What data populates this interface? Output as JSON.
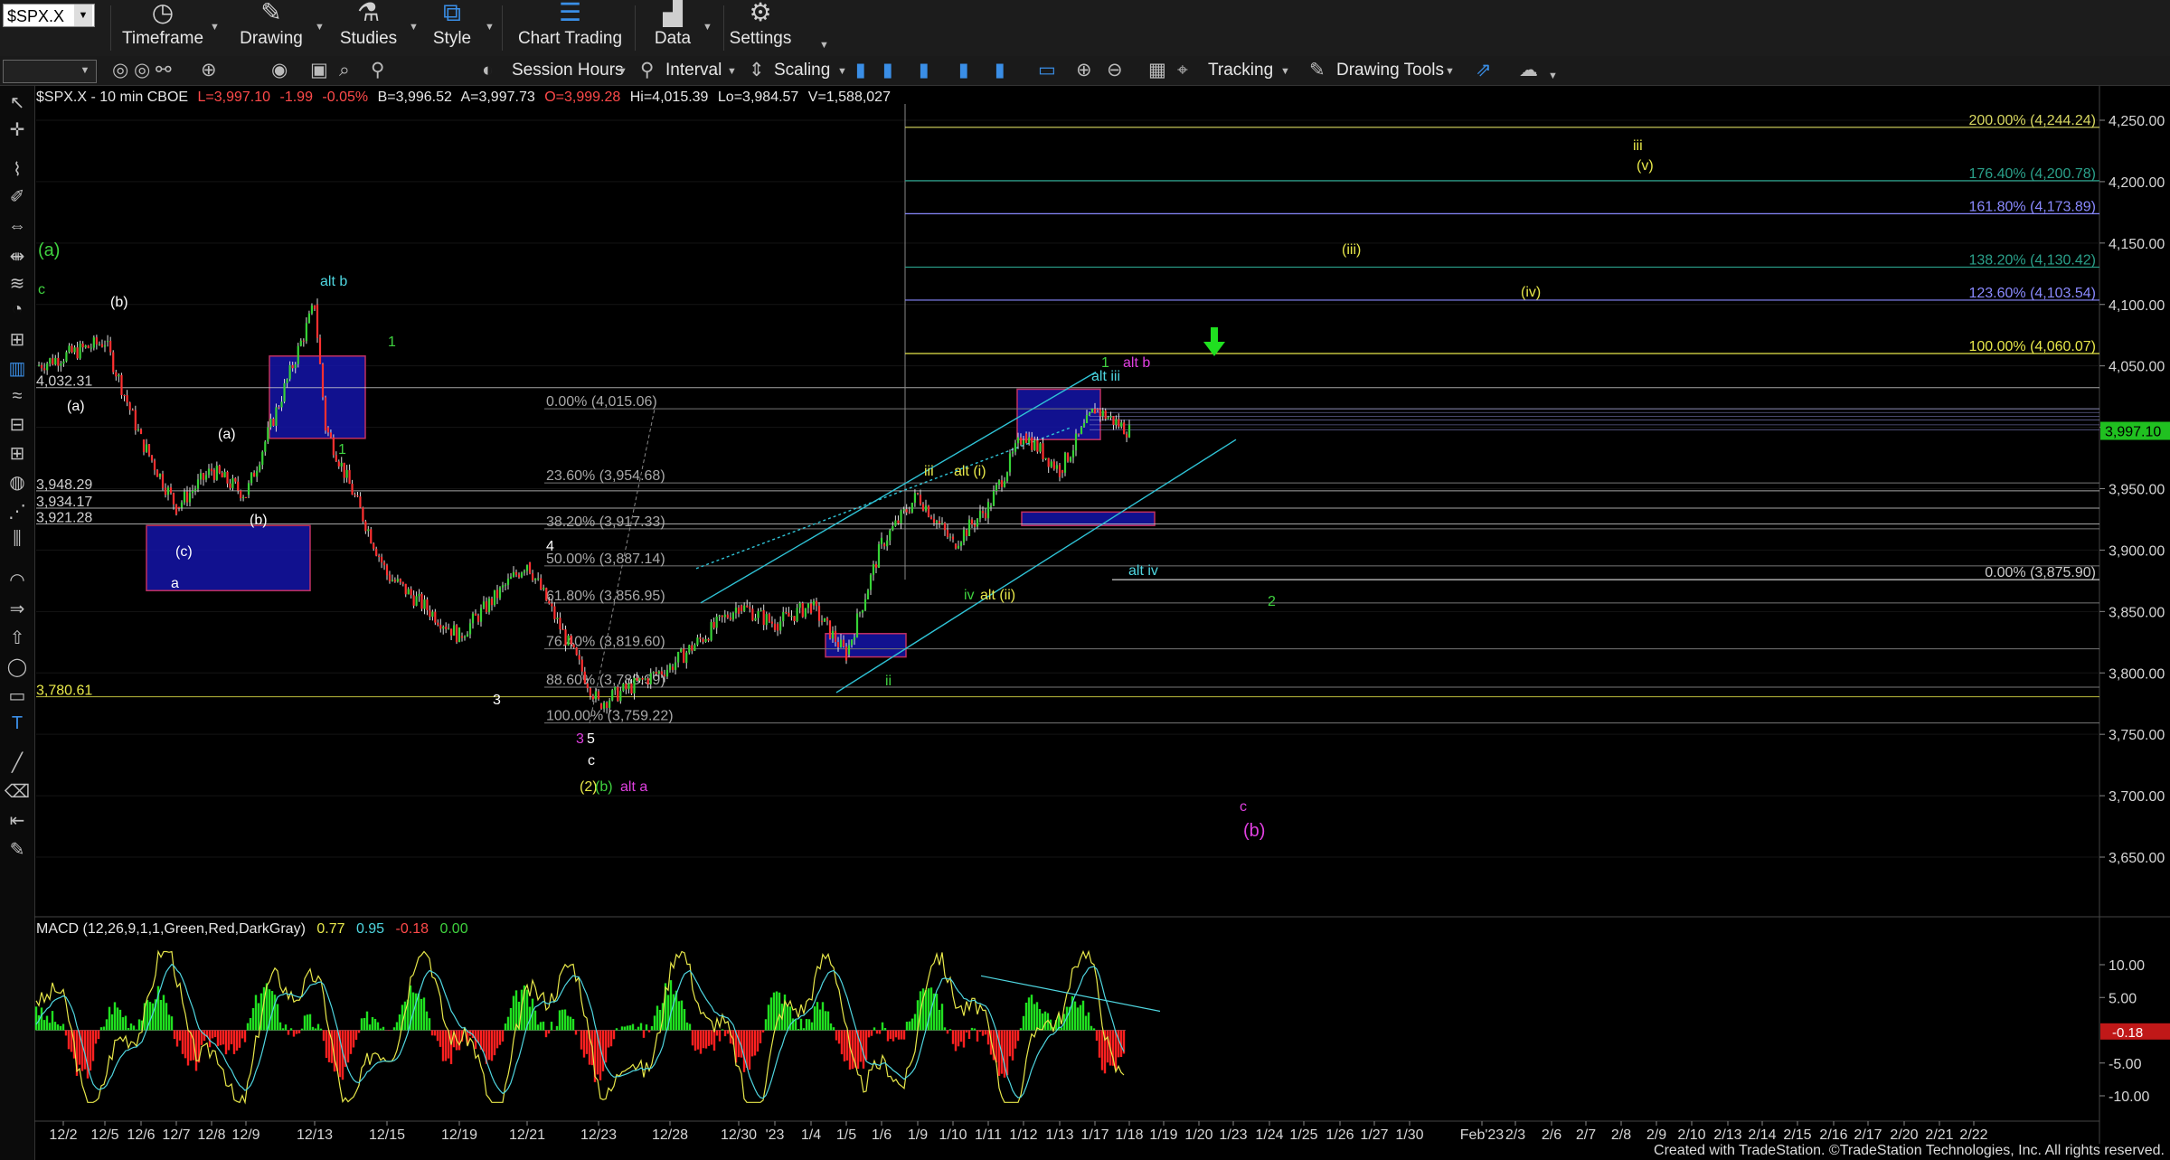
{
  "toolbar": {
    "symbol": "$SPX.X",
    "groups": [
      {
        "label": "Timeframe",
        "icon": "clock-icon"
      },
      {
        "label": "Drawing",
        "icon": "pencil-icon"
      },
      {
        "label": "Studies",
        "icon": "flask-icon"
      },
      {
        "label": "Style",
        "icon": "style-icon"
      },
      {
        "label": "Chart Trading",
        "icon": "chart-trading-icon"
      },
      {
        "label": "Data",
        "icon": "bar-chart-icon"
      },
      {
        "label": "Settings",
        "icon": "gear-icon"
      }
    ],
    "session_hours": "Session Hours",
    "interval": "Interval",
    "scaling": "Scaling",
    "tracking": "Tracking",
    "drawing_tools": "Drawing Tools"
  },
  "header": {
    "symbol_info": "$SPX.X - 10 min  CBOE",
    "last": "L=3,997.10",
    "change": "-1.99",
    "pct": "-0.05%",
    "bid": "B=3,996.52",
    "ask": "A=3,997.73",
    "open": "O=3,999.28",
    "high": "Hi=4,015.39",
    "low": "Lo=3,984.57",
    "volume": "V=1,588,027"
  },
  "chart_data": [
    {
      "type": "candlestick",
      "title": "$SPX.X - 10 min",
      "ylim": [
        3600,
        4270
      ],
      "y_ticks": [
        "4,250.00",
        "4,200.00",
        "4,150.00",
        "4,100.00",
        "4,050.00",
        "4,000.00",
        "3,950.00",
        "3,900.00",
        "3,850.00",
        "3,800.00",
        "3,750.00",
        "3,700.00",
        "3,650.00"
      ],
      "y_tick_values": [
        4250,
        4200,
        4150,
        4100,
        4050,
        4000,
        3950,
        3900,
        3850,
        3800,
        3750,
        3700,
        3650
      ],
      "x_ticks": [
        "12/2",
        "12/5",
        "12/6",
        "12/7",
        "12/8",
        "12/9",
        "12/13",
        "12/15",
        "12/19",
        "12/21",
        "12/23",
        "12/28",
        "12/30",
        "'23",
        "1/4",
        "1/5",
        "1/6",
        "1/9",
        "1/10",
        "1/11",
        "1/12",
        "1/13",
        "1/17",
        "1/18",
        "1/19",
        "1/20",
        "1/23",
        "1/24",
        "1/25",
        "1/26",
        "1/27",
        "1/30",
        "Feb'23",
        "2/3",
        "2/6",
        "2/7",
        "2/8",
        "2/9",
        "2/10",
        "2/13",
        "2/14",
        "2/15",
        "2/16",
        "2/17",
        "2/20",
        "2/21",
        "2/22"
      ],
      "last_price": "3,997.10",
      "price_path": [
        [
          "12/2",
          4050
        ],
        [
          "12/5",
          4070
        ],
        [
          "12/6",
          3990
        ],
        [
          "12/7",
          3935
        ],
        [
          "12/8",
          3965
        ],
        [
          "12/9",
          3945
        ],
        [
          "12/13",
          4100
        ],
        [
          "12/13",
          4000
        ],
        [
          "12/15",
          3880
        ],
        [
          "12/19",
          3830
        ],
        [
          "12/21",
          3890
        ],
        [
          "12/23",
          3775
        ],
        [
          "12/28",
          3805
        ],
        [
          "12/30",
          3855
        ],
        [
          "'23",
          3840
        ],
        [
          "1/4",
          3855
        ],
        [
          "1/5",
          3815
        ],
        [
          "1/6",
          3905
        ],
        [
          "1/9",
          3945
        ],
        [
          "1/10",
          3905
        ],
        [
          "1/11",
          3935
        ],
        [
          "1/12",
          3995
        ],
        [
          "1/13",
          3965
        ],
        [
          "1/17",
          4015
        ],
        [
          "1/18",
          3997
        ]
      ],
      "horizontal_levels": [
        {
          "label": "4,032.31",
          "value": 4032.31
        },
        {
          "label": "3,948.29",
          "value": 3948.29
        },
        {
          "label": "3,934.17",
          "value": 3934.17
        },
        {
          "label": "3,921.28",
          "value": 3921.28
        },
        {
          "label": "3,780.61",
          "value": 3780.61
        }
      ],
      "retracement_fib": [
        {
          "label": "0.00% (4,015.06)",
          "value": 4015.06
        },
        {
          "label": "23.60% (3,954.68)",
          "value": 3954.68
        },
        {
          "label": "38.20% (3,917.33)",
          "value": 3917.33
        },
        {
          "label": "50.00% (3,887.14)",
          "value": 3887.14
        },
        {
          "label": "61.80% (3,856.95)",
          "value": 3856.95
        },
        {
          "label": "76.40% (3,819.60)",
          "value": 3819.6
        },
        {
          "label": "88.60% (3,788.39)",
          "value": 3788.39
        },
        {
          "label": "100.00% (3,759.22)",
          "value": 3759.22
        }
      ],
      "extension_fib": [
        {
          "label": "200.00% (4,244.24)",
          "value": 4244.24,
          "color": "#d8d860"
        },
        {
          "label": "176.40% (4,200.78)",
          "value": 4200.78,
          "color": "#2aa08a"
        },
        {
          "label": "161.80% (4,173.89)",
          "value": 4173.89,
          "color": "#8a8aff"
        },
        {
          "label": "138.20% (4,130.42)",
          "value": 4130.42,
          "color": "#2aa08a"
        },
        {
          "label": "123.60% (4,103.54)",
          "value": 4103.54,
          "color": "#8a8aff"
        },
        {
          "label": "100.00% (4,060.07)",
          "value": 4060.07,
          "color": "#e8e84a"
        },
        {
          "label": "0.00% (3,875.90)",
          "value": 3875.9,
          "color": "#cccccc"
        }
      ],
      "wave_labels": [
        {
          "text": "(a)",
          "color": "#3fd23f"
        },
        {
          "text": "c",
          "color": "#3fd23f"
        },
        {
          "text": "(b)",
          "color": "#ffffff"
        },
        {
          "text": "(a)",
          "color": "#ffffff"
        },
        {
          "text": "alt b",
          "color": "#4fd6e0"
        },
        {
          "text": "1",
          "color": "#3fd23f"
        },
        {
          "text": "1",
          "color": "#3fd23f"
        },
        {
          "text": "(a)",
          "color": "#ffffff"
        },
        {
          "text": "(b)",
          "color": "#ffffff"
        },
        {
          "text": "(c)",
          "color": "#ffffff"
        },
        {
          "text": "a",
          "color": "#ffffff"
        },
        {
          "text": "4",
          "color": "#ffffff"
        },
        {
          "text": "3",
          "color": "#ffffff"
        },
        {
          "text": "3",
          "color": "#e040e0"
        },
        {
          "text": "5",
          "color": "#ffffff"
        },
        {
          "text": "c",
          "color": "#ffffff"
        },
        {
          "text": "(2)",
          "color": "#e8e84a"
        },
        {
          "text": "(b)",
          "color": "#3fd23f"
        },
        {
          "text": "alt a",
          "color": "#e040e0"
        },
        {
          "text": "iii",
          "color": "#e8e84a"
        },
        {
          "text": "alt (i)",
          "color": "#e8e84a"
        },
        {
          "text": "iv",
          "color": "#3fd23f"
        },
        {
          "text": "alt (ii)",
          "color": "#e8e84a"
        },
        {
          "text": "ii",
          "color": "#3fd23f"
        },
        {
          "text": "alt iii",
          "color": "#4fd6e0"
        },
        {
          "text": "1",
          "color": "#3fd23f"
        },
        {
          "text": "alt b",
          "color": "#e040e0"
        },
        {
          "text": "alt iv",
          "color": "#4fd6e0"
        },
        {
          "text": "2",
          "color": "#3fd23f"
        },
        {
          "text": "iii",
          "color": "#e8e84a"
        },
        {
          "text": "(v)",
          "color": "#e8e84a"
        },
        {
          "text": "(iii)",
          "color": "#e8e84a"
        },
        {
          "text": "(iv)",
          "color": "#e8e84a"
        },
        {
          "text": "c",
          "color": "#e040e0"
        },
        {
          "text": "(b)",
          "color": "#e040e0"
        }
      ]
    },
    {
      "type": "line",
      "title": "MACD (12,26,9,1,1,Green,Red,DarkGray)",
      "values_shown": [
        "0.77",
        "0.95",
        "-0.18",
        "0.00"
      ],
      "ylim": [
        -11.5,
        12.5
      ],
      "y_ticks": [
        "10.00",
        "5.00",
        "-5.00",
        "-10.00"
      ],
      "y_tick_values": [
        10,
        5,
        -5,
        -10
      ],
      "last_value": "-0.18"
    }
  ],
  "footer": "Created with TradeStation. ©TradeStation Technologies, Inc. All rights reserved."
}
